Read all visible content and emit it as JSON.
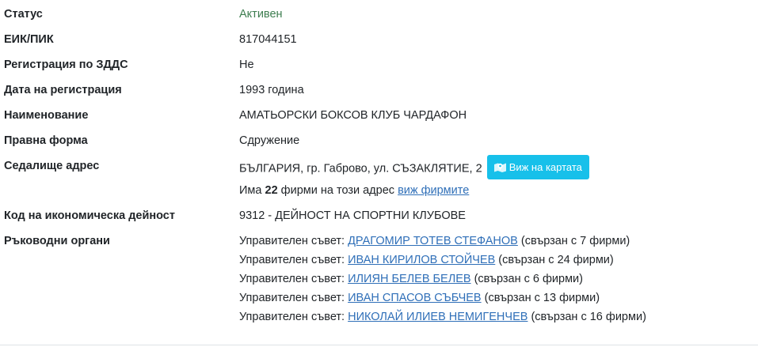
{
  "rows": {
    "status": {
      "label": "Статус",
      "value": "Активен"
    },
    "eik": {
      "label": "ЕИК/ПИК",
      "value": "817044151"
    },
    "vat": {
      "label": "Регистрация по ЗДДС",
      "value": "Не"
    },
    "reg_date": {
      "label": "Дата на регистрация",
      "value": "1993 година"
    },
    "name": {
      "label": "Наименование",
      "value": "АМАТЬОРСКИ БОКСОВ КЛУБ ЧАРДАФОН"
    },
    "legal_form": {
      "label": "Правна форма",
      "value": "Сдружение"
    },
    "address": {
      "label": "Седалище адрес",
      "value": "БЪЛГАРИЯ, гр. Габрово, ул. СЪЗАКЛЯТИЕ, 2",
      "map_button": "Виж на картата",
      "firms_prefix": "Има",
      "firms_count": "22",
      "firms_suffix": "фирми на този адрес",
      "firms_link": "виж фирмите"
    },
    "activity": {
      "label": "Код на икономическа дейност",
      "value": "9312 - ДЕЙНОСТ НА СПОРТНИ КЛУБОВЕ"
    },
    "management": {
      "label": "Ръководни органи",
      "members": [
        {
          "role": "Управителен съвет:",
          "name": "ДРАГОМИР ТОТЕВ СТЕФАНОВ",
          "note": "(свързан с 7 фирми)"
        },
        {
          "role": "Управителен съвет:",
          "name": "ИВАН КИРИЛОВ СТОЙЧЕВ",
          "note": "(свързан с 24 фирми)"
        },
        {
          "role": "Управителен съвет:",
          "name": "ИЛИЯН БЕЛЕВ БЕЛЕВ",
          "note": "(свързан с 6 фирми)"
        },
        {
          "role": "Управителен съвет:",
          "name": "ИВАН СПАСОВ СЪБЧЕВ",
          "note": "(свързан с 13 фирми)"
        },
        {
          "role": "Управителен съвет:",
          "name": "НИКОЛАЙ ИЛИЕВ НЕМИГЕНЧЕВ",
          "note": "(свързан с 16 фирми)"
        }
      ]
    }
  },
  "colors": {
    "status_active": "#3d7d4f",
    "link": "#2f6fb8",
    "map_button_bg": "#17c0ea"
  },
  "icons": {
    "map_button_icon": "map-marker-icon"
  }
}
